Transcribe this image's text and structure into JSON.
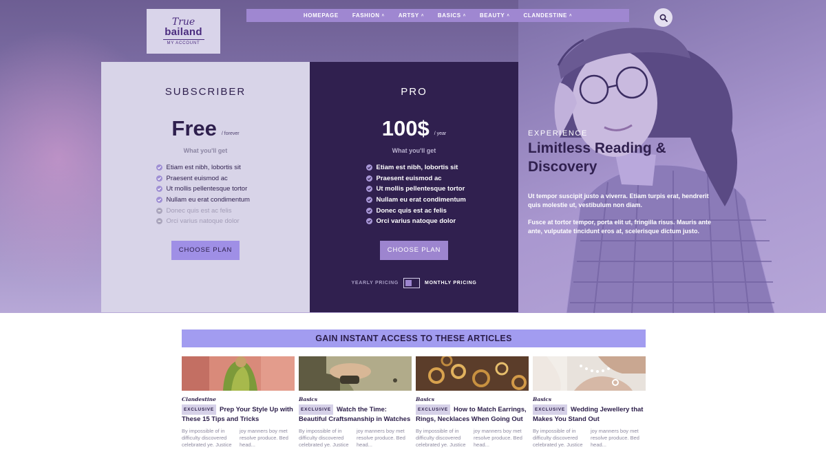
{
  "logo": {
    "mark": "True",
    "name": "bailand",
    "sub": "MY ACCOUNT"
  },
  "nav": {
    "items": [
      {
        "label": "HOMEPAGE",
        "chevron": false
      },
      {
        "label": "FASHION",
        "chevron": true
      },
      {
        "label": "ARTSY",
        "chevron": true
      },
      {
        "label": "BASICS",
        "chevron": true
      },
      {
        "label": "BEAUTY",
        "chevron": true
      },
      {
        "label": "CLANDESTINE",
        "chevron": true
      }
    ],
    "chevron_glyph": "˄",
    "search_icon": "search-icon"
  },
  "plans": {
    "subscriber": {
      "title": "SUBSCRIBER",
      "price": "Free",
      "period": "/ forever",
      "what": "What you'll get",
      "features": [
        {
          "text": "Etiam est nibh, lobortis sit",
          "included": true
        },
        {
          "text": "Praesent euismod ac",
          "included": true
        },
        {
          "text": "Ut mollis pellentesque tortor",
          "included": true
        },
        {
          "text": "Nullam eu erat condimentum",
          "included": true
        },
        {
          "text": "Donec quis est ac felis",
          "included": false
        },
        {
          "text": "Orci varius natoque dolor",
          "included": false
        }
      ],
      "button": "CHOOSE PLAN"
    },
    "pro": {
      "title": "PRO",
      "price": "100$",
      "period": "/ year",
      "what": "What you'll get",
      "features": [
        {
          "text": "Etiam est nibh, lobortis sit",
          "included": true
        },
        {
          "text": "Praesent euismod ac",
          "included": true
        },
        {
          "text": "Ut mollis pellentesque tortor",
          "included": true
        },
        {
          "text": "Nullam eu erat condimentum",
          "included": true
        },
        {
          "text": "Donec quis est ac felis",
          "included": true
        },
        {
          "text": "Orci varius natoque dolor",
          "included": true
        }
      ],
      "button": "CHOOSE PLAN",
      "toggle": {
        "yearly": "YEARLY PRICING",
        "monthly": "MONTHLY PRICING"
      }
    }
  },
  "hero": {
    "eyebrow": "EXPERIENCE",
    "headline": "Limitless Reading & Discovery",
    "body1": "Ut tempor suscipit justo a viverra. Etiam turpis erat, hendrerit quis molestie ut, vestibulum non diam.",
    "body2": "Fusce at tortor tempor, porta elit ut, fringilla risus. Mauris ante ante, vulputate tincidunt eros at, scelerisque dictum justo."
  },
  "articles_section": {
    "title": "GAIN INSTANT ACCESS TO THESE ARTICLES",
    "badge": "EXCLUSIVE",
    "items": [
      {
        "category": "Clandestine",
        "title": "Prep Your Style Up with These 15 Tips and Tricks",
        "excerpt_left": "By impossible of in difficulty discovered celebrated ye. Justice",
        "excerpt_right": "joy manners boy met resolve produce. Bed head..."
      },
      {
        "category": "Basics",
        "title": "Watch the Time: Beautiful Craftsmanship in Watches",
        "excerpt_left": "By impossible of in difficulty discovered celebrated ye. Justice",
        "excerpt_right": "joy manners boy met resolve produce. Bed head..."
      },
      {
        "category": "Basics",
        "title": "How to Match Earrings, Rings, Necklaces When Going Out",
        "excerpt_left": "By impossible of in difficulty discovered celebrated ye. Justice",
        "excerpt_right": "joy manners boy met resolve produce. Bed head..."
      },
      {
        "category": "Basics",
        "title": "Wedding Jewellery that Makes You Stand Out",
        "excerpt_left": "By impossible of in difficulty discovered celebrated ye. Justice",
        "excerpt_right": "joy manners boy met resolve produce. Bed head..."
      }
    ]
  },
  "colors": {
    "brand_purple": "#30204f",
    "accent_lavender": "#a29cf0",
    "nav_purple": "#9f87d1"
  }
}
